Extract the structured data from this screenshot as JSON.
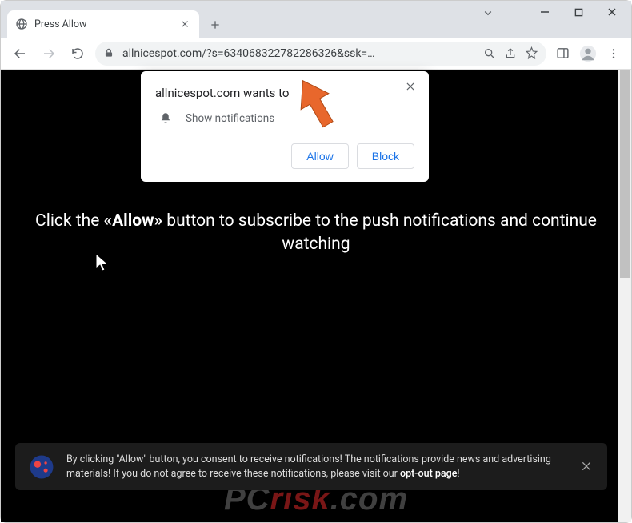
{
  "tab": {
    "title": "Press Allow"
  },
  "url": "allnicespot.com/?s=634068322782286326&ssk=…",
  "permission": {
    "host_wants": "allnicespot.com wants to",
    "line": "Show notifications",
    "allow": "Allow",
    "block": "Block"
  },
  "main": {
    "pre": "Click the ",
    "bold": "«Allow»",
    "post": " button to subscribe to the push notifications and continue watching"
  },
  "banner": {
    "line1": "By clicking \"Allow\" button, you consent to receive notifications! The notifications provide news and advertising",
    "line2_pre": "materials! If you do not agree to receive these notifications, please visit our ",
    "link": "opt-out page",
    "line2_post": "!"
  },
  "watermark": {
    "pc": "PC",
    "risk": "risk",
    "dotcom": ".com"
  }
}
